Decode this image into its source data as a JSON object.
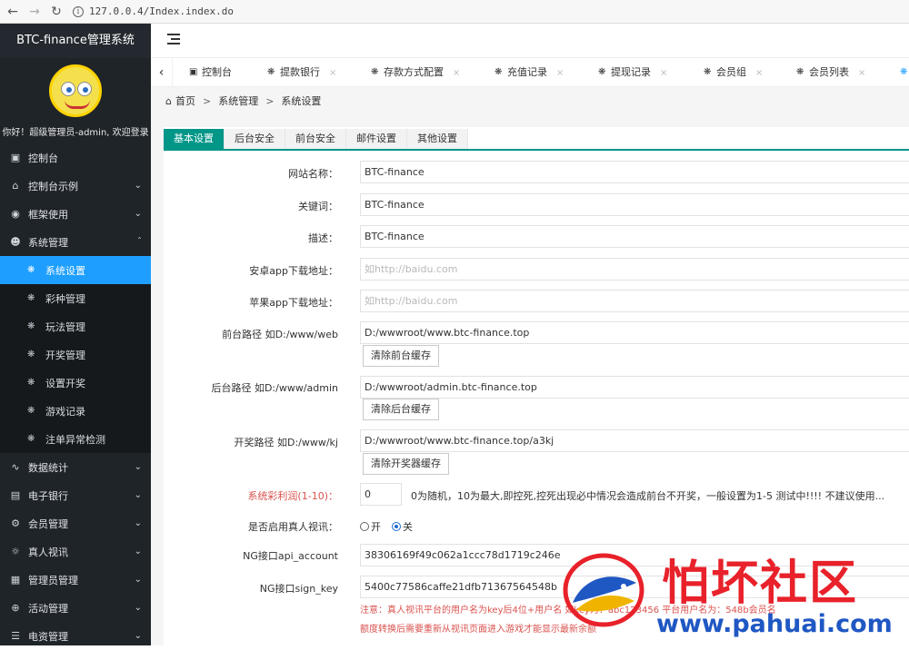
{
  "browser": {
    "url": "127.0.0.4/Index.index.do"
  },
  "sidebar": {
    "brand": "BTC-finance管理系统",
    "welcome": "你好！超级管理员-admin, 欢迎登录",
    "items": [
      {
        "label": "控制台",
        "icon": "monitor-icon"
      },
      {
        "label": "控制台示例",
        "icon": "home-icon"
      },
      {
        "label": "框架使用",
        "icon": "layers-icon"
      },
      {
        "label": "系统管理",
        "icon": "user-icon"
      }
    ],
    "sub_items": [
      {
        "label": "系统设置"
      },
      {
        "label": "彩种管理"
      },
      {
        "label": "玩法管理"
      },
      {
        "label": "开奖管理"
      },
      {
        "label": "设置开奖"
      },
      {
        "label": "游戏记录"
      },
      {
        "label": "注单异常检测"
      }
    ],
    "bottom_items": [
      {
        "label": "数据统计",
        "icon": "chart-icon"
      },
      {
        "label": "电子银行",
        "icon": "bank-icon"
      },
      {
        "label": "会员管理",
        "icon": "gear-icon"
      },
      {
        "label": "真人视讯",
        "icon": "video-icon"
      },
      {
        "label": "管理员管理",
        "icon": "grid-icon"
      },
      {
        "label": "活动管理",
        "icon": "plus-circle-icon"
      },
      {
        "label": "电资管理",
        "icon": "list-icon"
      }
    ]
  },
  "tabs": [
    {
      "label": "控制台",
      "closable": false
    },
    {
      "label": "提款银行",
      "closable": true
    },
    {
      "label": "存款方式配置",
      "closable": true
    },
    {
      "label": "充值记录",
      "closable": true
    },
    {
      "label": "提现记录",
      "closable": true
    },
    {
      "label": "会员组",
      "closable": true
    },
    {
      "label": "会员列表",
      "closable": true
    }
  ],
  "breadcrumb": {
    "home": "首页",
    "level1": "系统管理",
    "level2": "系统设置"
  },
  "form_tabs": [
    "基本设置",
    "后台安全",
    "前台安全",
    "邮件设置",
    "其他设置"
  ],
  "form": {
    "site_name_label": "网站名称：",
    "site_name": "BTC-finance",
    "keywords_label": "关键词：",
    "keywords": "BTC-finance",
    "desc_label": "描述：",
    "desc": "BTC-finance",
    "android_label": "安卓app下载地址：",
    "android_placeholder": "如http://baidu.com",
    "ios_label": "苹果app下载地址：",
    "ios_placeholder": "如http://baidu.com",
    "front_path_label": "前台路径 如D:/www/web",
    "front_path": "D:/wwwroot/www.btc-finance.top",
    "front_clear": "清除前台缓存",
    "admin_path_label": "后台路径 如D:/www/admin",
    "admin_path": "D:/wwwroot/admin.btc-finance.top",
    "admin_clear": "清除后台缓存",
    "kj_path_label": "开奖路径 如D:/www/kj",
    "kj_path": "D:/wwwroot/www.btc-finance.top/a3kj",
    "kj_clear": "清除开奖器缓存",
    "profit_label": "系统彩利润(1-10)：",
    "profit_value": "0",
    "profit_hint": "0为随机，10为最大,即控死,控死出现必中情况会造成前台不开奖，一般设置为1-5 测试中!!!! 不建议使用...",
    "live_label": "是否启用真人视讯：",
    "live_on": "开",
    "live_off": "关",
    "ng_account_label": "NG接口api_account",
    "ng_account": "38306169f49c062a1ccc78d1719c246e",
    "ng_key_label": "NG接口sign_key",
    "ng_key": "5400c77586caffe21dfb71367564548b",
    "note1": "注意：真人视讯平台的用户名为key后4位+用户名 如key为：abc123456 平台用户名为：548b会员名",
    "note2": "额度转换后需要重新从视讯页面进入游戏才能显示最新余额"
  },
  "watermark": {
    "title": "怕坏社区",
    "url": "www.pahuai.com"
  }
}
